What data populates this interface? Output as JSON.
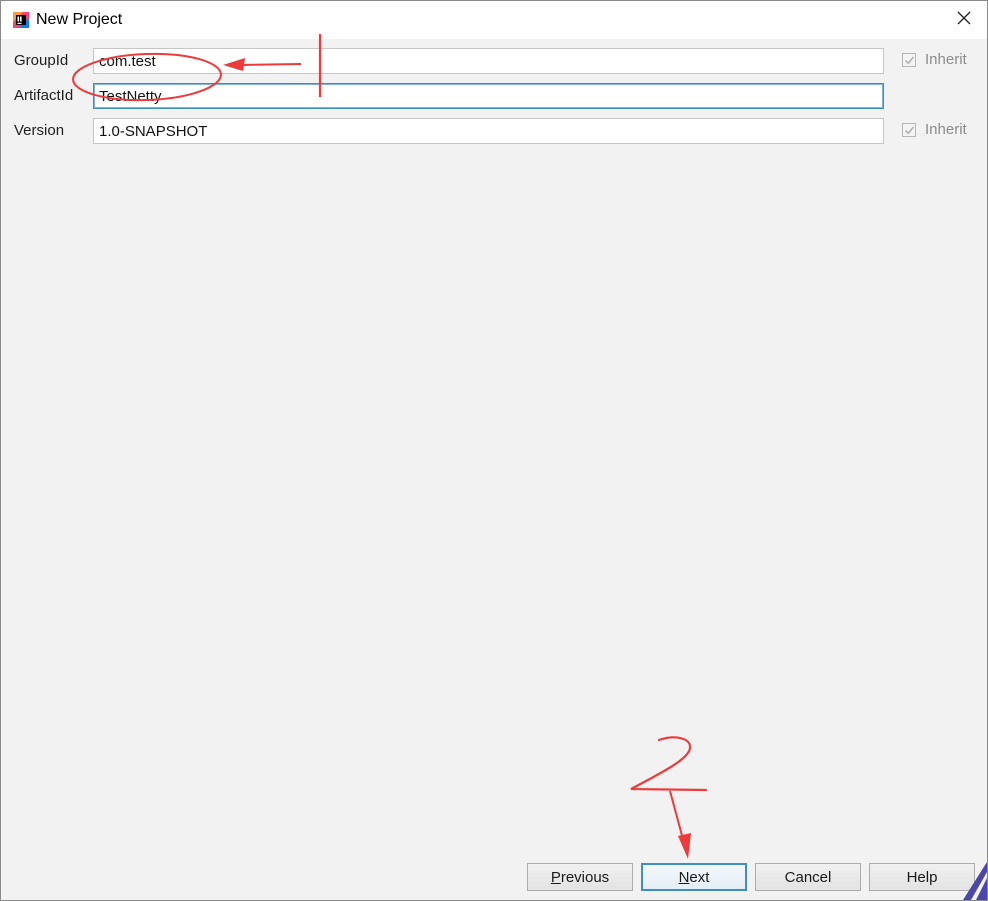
{
  "window": {
    "title": "New Project"
  },
  "form": {
    "group_id": {
      "label": "GroupId",
      "value": "com.test",
      "inherit_label": "Inherit",
      "inherit_checked": true
    },
    "artifact_id": {
      "label": "ArtifactId",
      "value": "TestNetty"
    },
    "version": {
      "label": "Version",
      "value": "1.0-SNAPSHOT",
      "inherit_label": "Inherit",
      "inherit_checked": true
    }
  },
  "buttons": {
    "previous": {
      "mnemonic": "P",
      "rest": "revious"
    },
    "next": {
      "mnemonic": "N",
      "rest": "ext"
    },
    "cancel": "Cancel",
    "help": "Help"
  },
  "colors": {
    "annotation": "#ee3a3a",
    "focus_border": "#3d8dcc"
  },
  "icons": {
    "app": "intellij-idea-icon",
    "close": "close-icon",
    "inherit_check": "checkmark-icon"
  }
}
